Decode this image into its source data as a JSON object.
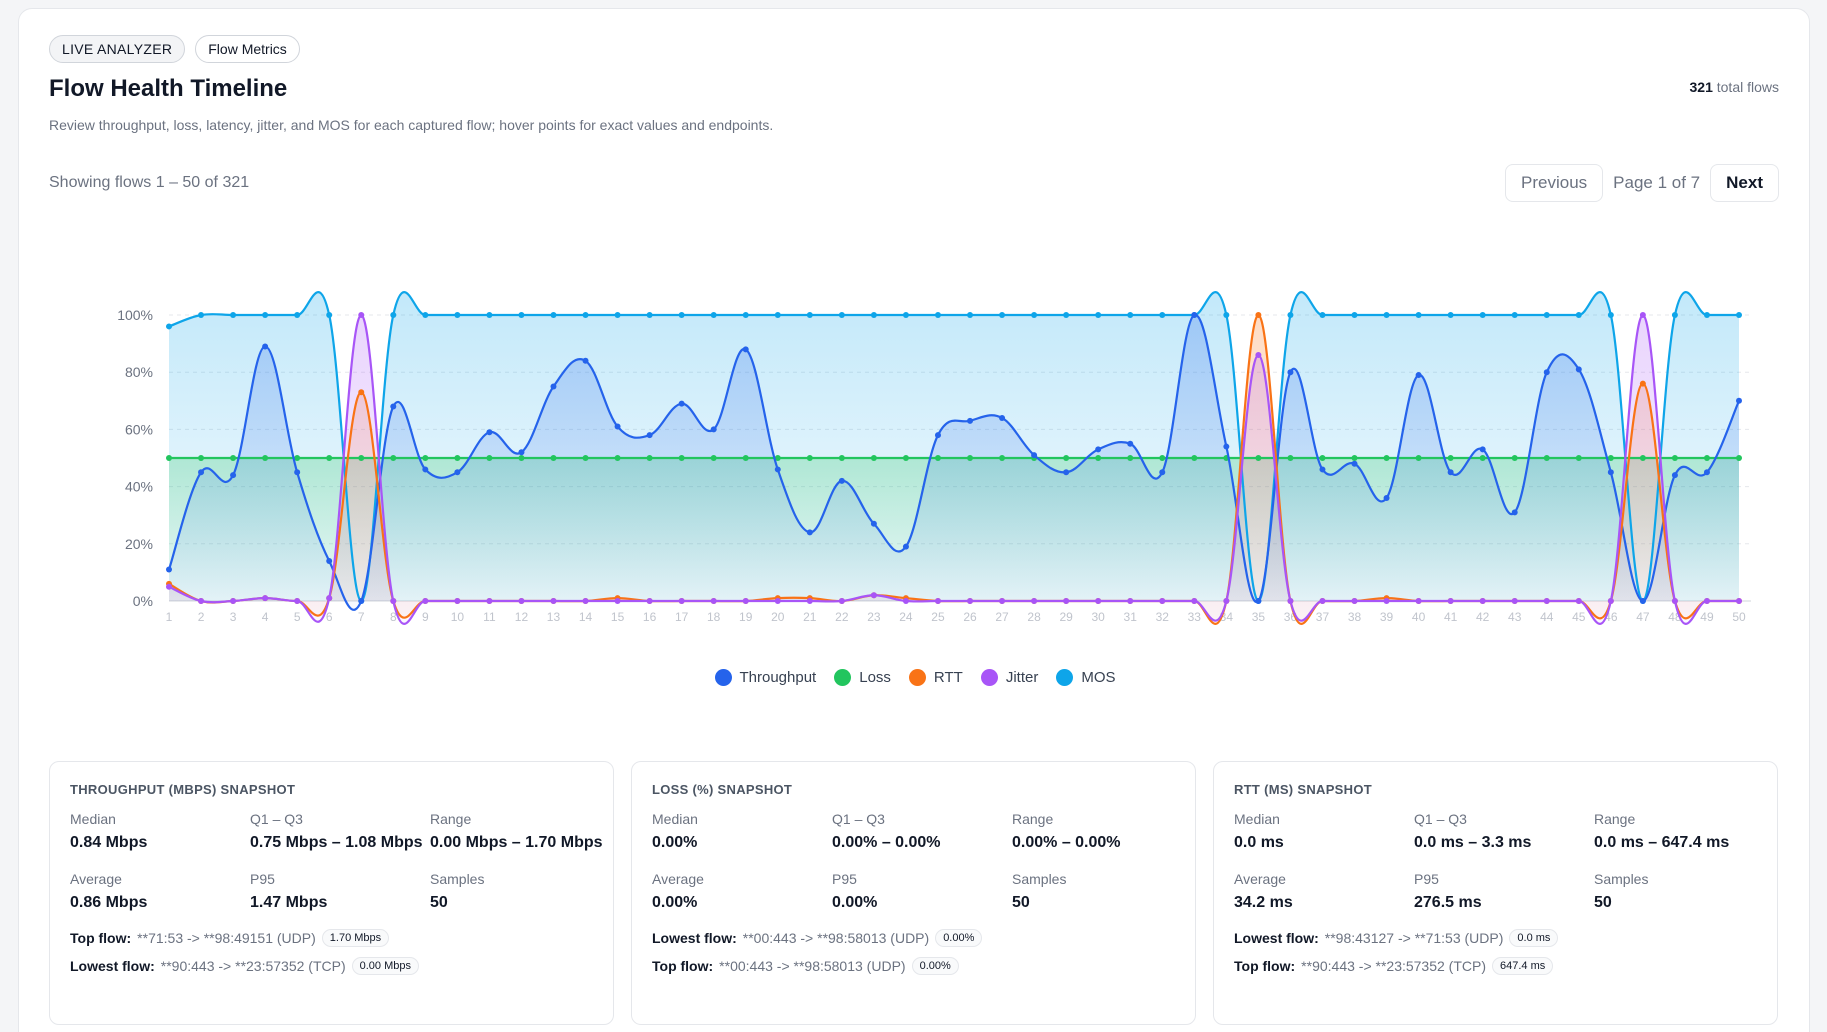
{
  "header": {
    "badges": [
      "LIVE ANALYZER",
      "Flow Metrics"
    ],
    "title": "Flow Health Timeline",
    "subtitle": "Review throughput, loss, latency, jitter, and MOS for each captured flow; hover points for exact values and endpoints.",
    "total_count": "321",
    "total_label": "total flows"
  },
  "pagination": {
    "showing": "Showing flows 1 – 50 of 321",
    "previous_label": "Previous",
    "page_info": "Page 1 of 7",
    "next_label": "Next"
  },
  "chart_data": {
    "type": "area",
    "x": [
      1,
      2,
      3,
      4,
      5,
      6,
      7,
      8,
      9,
      10,
      11,
      12,
      13,
      14,
      15,
      16,
      17,
      18,
      19,
      20,
      21,
      22,
      23,
      24,
      25,
      26,
      27,
      28,
      29,
      30,
      31,
      32,
      33,
      34,
      35,
      36,
      37,
      38,
      39,
      40,
      41,
      42,
      43,
      44,
      45,
      46,
      47,
      48,
      49,
      50
    ],
    "y_ticks": [
      "0%",
      "20%",
      "40%",
      "60%",
      "80%",
      "100%"
    ],
    "ylim": [
      0,
      100
    ],
    "grid": true,
    "legend_position": "bottom",
    "series": [
      {
        "name": "Throughput",
        "color": "#2563eb",
        "values": [
          11,
          45,
          44,
          89,
          45,
          14,
          0,
          68,
          46,
          45,
          59,
          52,
          75,
          84,
          61,
          58,
          69,
          60,
          88,
          46,
          24,
          42,
          27,
          19,
          58,
          63,
          64,
          51,
          45,
          53,
          55,
          45,
          100,
          54,
          0,
          80,
          46,
          48,
          36,
          79,
          45,
          53,
          31,
          80,
          81,
          45,
          0,
          44,
          45,
          70
        ]
      },
      {
        "name": "Loss",
        "color": "#22c55e",
        "values": [
          50,
          50,
          50,
          50,
          50,
          50,
          50,
          50,
          50,
          50,
          50,
          50,
          50,
          50,
          50,
          50,
          50,
          50,
          50,
          50,
          50,
          50,
          50,
          50,
          50,
          50,
          50,
          50,
          50,
          50,
          50,
          50,
          50,
          50,
          50,
          50,
          50,
          50,
          50,
          50,
          50,
          50,
          50,
          50,
          50,
          50,
          50,
          50,
          50,
          50
        ]
      },
      {
        "name": "RTT",
        "color": "#f97316",
        "values": [
          6,
          0,
          0,
          1,
          0,
          1,
          73,
          0,
          0,
          0,
          0,
          0,
          0,
          0,
          1,
          0,
          0,
          0,
          0,
          1,
          1,
          0,
          2,
          1,
          0,
          0,
          0,
          0,
          0,
          0,
          0,
          0,
          0,
          0,
          100,
          0,
          0,
          0,
          1,
          0,
          0,
          0,
          0,
          0,
          0,
          0,
          76,
          0,
          0,
          0
        ]
      },
      {
        "name": "Jitter",
        "color": "#a855f7",
        "values": [
          5,
          0,
          0,
          1,
          0,
          1,
          100,
          0,
          0,
          0,
          0,
          0,
          0,
          0,
          0,
          0,
          0,
          0,
          0,
          0,
          0,
          0,
          2,
          0,
          0,
          0,
          0,
          0,
          0,
          0,
          0,
          0,
          0,
          0,
          86,
          0,
          0,
          0,
          0,
          0,
          0,
          0,
          0,
          0,
          0,
          0,
          100,
          0,
          0,
          0
        ]
      },
      {
        "name": "MOS",
        "color": "#0ea5e9",
        "values": [
          96,
          100,
          100,
          100,
          100,
          100,
          0,
          100,
          100,
          100,
          100,
          100,
          100,
          100,
          100,
          100,
          100,
          100,
          100,
          100,
          100,
          100,
          100,
          100,
          100,
          100,
          100,
          100,
          100,
          100,
          100,
          100,
          100,
          100,
          0,
          100,
          100,
          100,
          100,
          100,
          100,
          100,
          100,
          100,
          100,
          100,
          0,
          100,
          100,
          100
        ]
      }
    ]
  },
  "panels": [
    {
      "title": "THROUGHPUT (MBPS) SNAPSHOT",
      "stats": [
        {
          "label": "Median",
          "value": "0.84 Mbps"
        },
        {
          "label": "Q1 – Q3",
          "value": "0.75 Mbps – 1.08 Mbps"
        },
        {
          "label": "Range",
          "value": "0.00 Mbps – 1.70 Mbps"
        },
        {
          "label": "Average",
          "value": "0.86 Mbps"
        },
        {
          "label": "P95",
          "value": "1.47 Mbps"
        },
        {
          "label": "Samples",
          "value": "50"
        }
      ],
      "flows": [
        {
          "label": "Top flow:",
          "endpoints": "**71:53 -> **98:49151 (UDP)",
          "value": "1.70 Mbps"
        },
        {
          "label": "Lowest flow:",
          "endpoints": "**90:443 -> **23:57352 (TCP)",
          "value": "0.00 Mbps"
        }
      ]
    },
    {
      "title": "LOSS (%) SNAPSHOT",
      "stats": [
        {
          "label": "Median",
          "value": "0.00%"
        },
        {
          "label": "Q1 – Q3",
          "value": "0.00% – 0.00%"
        },
        {
          "label": "Range",
          "value": "0.00% – 0.00%"
        },
        {
          "label": "Average",
          "value": "0.00%"
        },
        {
          "label": "P95",
          "value": "0.00%"
        },
        {
          "label": "Samples",
          "value": "50"
        }
      ],
      "flows": [
        {
          "label": "Lowest flow:",
          "endpoints": "**00:443 -> **98:58013 (UDP)",
          "value": "0.00%"
        },
        {
          "label": "Top flow:",
          "endpoints": "**00:443 -> **98:58013 (UDP)",
          "value": "0.00%"
        }
      ]
    },
    {
      "title": "RTT (MS) SNAPSHOT",
      "stats": [
        {
          "label": "Median",
          "value": "0.0 ms"
        },
        {
          "label": "Q1 – Q3",
          "value": "0.0 ms – 3.3 ms"
        },
        {
          "label": "Range",
          "value": "0.0 ms – 647.4 ms"
        },
        {
          "label": "Average",
          "value": "34.2 ms"
        },
        {
          "label": "P95",
          "value": "276.5 ms"
        },
        {
          "label": "Samples",
          "value": "50"
        }
      ],
      "flows": [
        {
          "label": "Lowest flow:",
          "endpoints": "**98:43127 -> **71:53 (UDP)",
          "value": "0.0 ms"
        },
        {
          "label": "Top flow:",
          "endpoints": "**90:443 -> **23:57352 (TCP)",
          "value": "647.4 ms"
        }
      ]
    }
  ]
}
